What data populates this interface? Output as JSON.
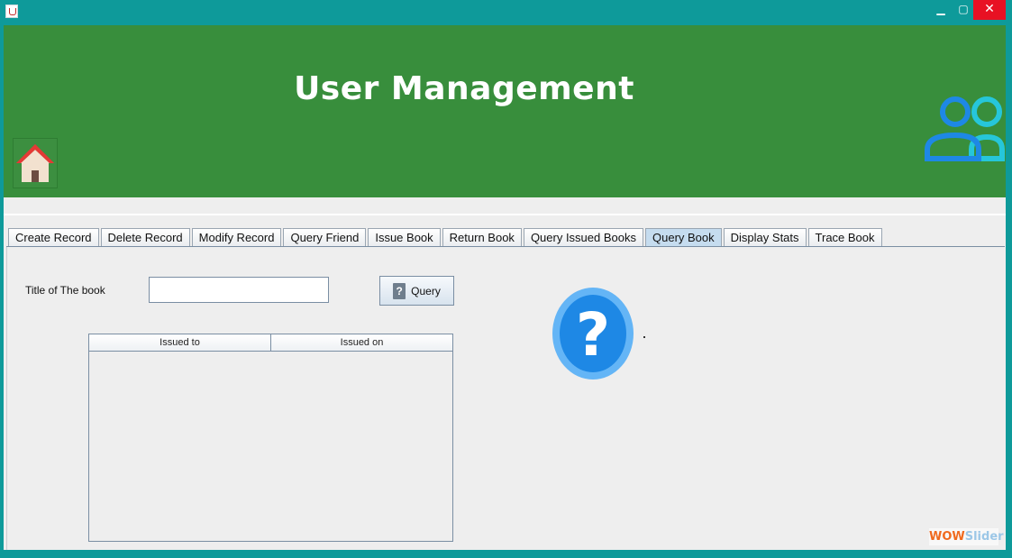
{
  "window": {
    "minimize": "▁",
    "maximize": "▢",
    "close": "✕"
  },
  "header": {
    "title": "User Management",
    "home_icon": "home-icon",
    "users_icon": "users-icon"
  },
  "tabs": [
    {
      "label": "Create Record",
      "active": false
    },
    {
      "label": "Delete Record",
      "active": false
    },
    {
      "label": "Modify Record",
      "active": false
    },
    {
      "label": "Query Friend",
      "active": false
    },
    {
      "label": "Issue Book",
      "active": false
    },
    {
      "label": "Return Book",
      "active": false
    },
    {
      "label": "Query Issued Books",
      "active": false
    },
    {
      "label": "Query Book",
      "active": true
    },
    {
      "label": "Display Stats",
      "active": false
    },
    {
      "label": "Trace Book",
      "active": false
    }
  ],
  "query_book": {
    "title_label": "Title of The book",
    "title_value": "",
    "query_button": "Query",
    "table": {
      "columns": [
        "Issued to",
        "Issued on"
      ],
      "rows": []
    }
  },
  "watermark": {
    "part1": "WOW",
    "part2": "Slider"
  },
  "colors": {
    "header_green": "#388e3c",
    "frame_teal": "#0e9a9a",
    "active_tab": "#c5dcef",
    "question_blue": "#1e88e5"
  }
}
